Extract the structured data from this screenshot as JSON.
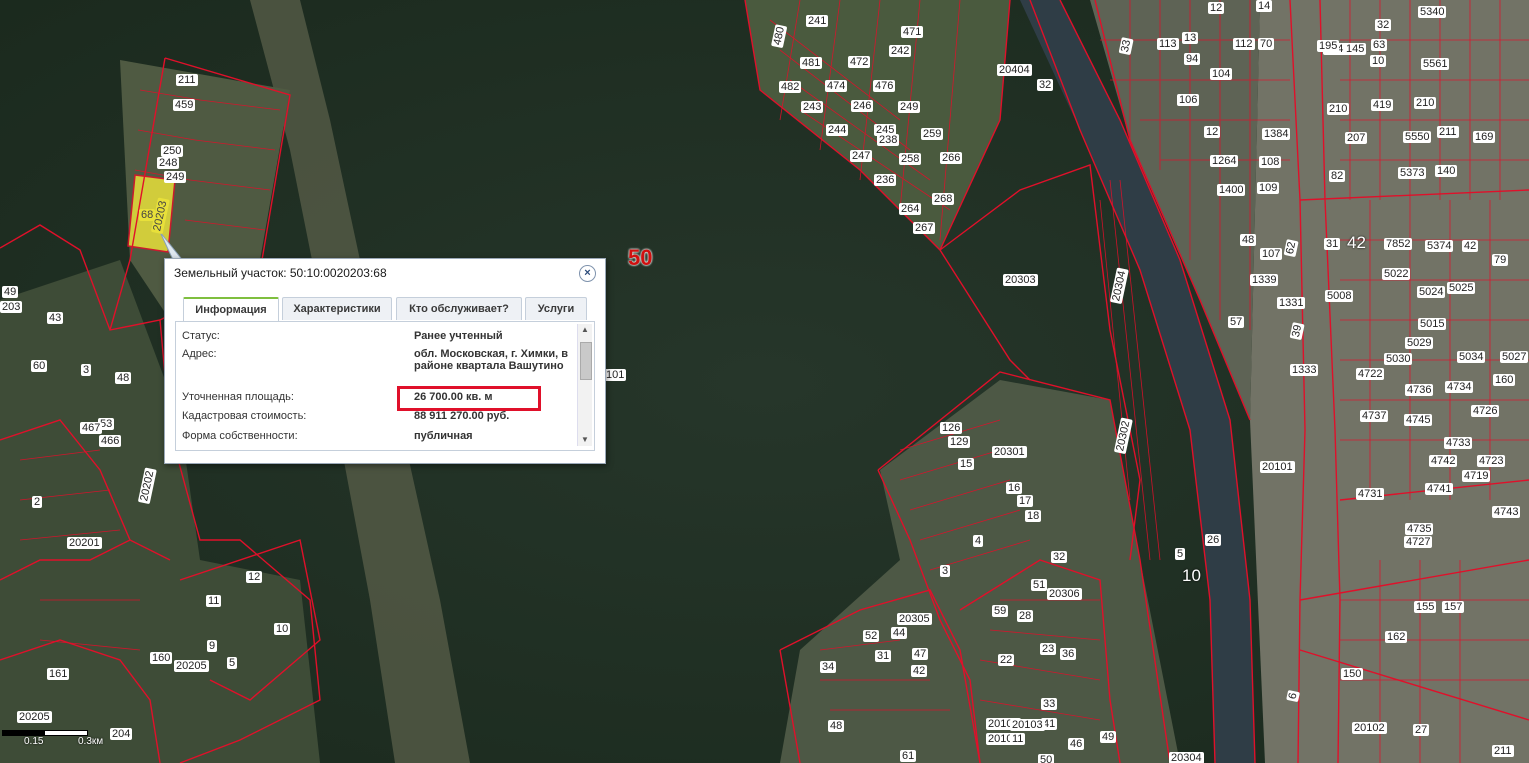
{
  "map": {
    "big_labels": [
      {
        "text": "50"
      }
    ],
    "mid_labels": [
      {
        "text": "42"
      },
      {
        "text": "10"
      }
    ],
    "parcel_labels": [
      "211",
      "459",
      "250",
      "248",
      "249",
      "68",
      "20203",
      "49",
      "203",
      "43",
      "60",
      "3",
      "48",
      "53",
      "467",
      "466",
      "20202",
      "2",
      "20201",
      "12",
      "11",
      "10",
      "160",
      "9",
      "5",
      "20205",
      "161",
      "20205",
      "204",
      "241",
      "471",
      "242",
      "480",
      "481",
      "472",
      "476",
      "482",
      "474",
      "243",
      "246",
      "249",
      "244",
      "245",
      "238",
      "259",
      "247",
      "236",
      "258",
      "266",
      "267",
      "264",
      "268",
      "20404",
      "32",
      "20303",
      "20304",
      "20301",
      "20302",
      "101",
      "126",
      "129",
      "15",
      "16",
      "17",
      "18",
      "4",
      "3",
      "20305",
      "52",
      "44",
      "47",
      "42",
      "34",
      "31",
      "32",
      "51",
      "59",
      "22",
      "20306",
      "28",
      "23",
      "36",
      "33",
      "41",
      "46",
      "49",
      "50",
      "48",
      "61",
      "20105",
      "20102",
      "20103",
      "11",
      "12",
      "14",
      "13",
      "94",
      "104",
      "70",
      "113",
      "112",
      "33",
      "106",
      "12",
      "1384",
      "1264",
      "108",
      "1400",
      "109",
      "48",
      "107",
      "62",
      "39",
      "1333",
      "1331",
      "1339",
      "57",
      "5",
      "26",
      "20101",
      "20304",
      "32",
      "63",
      "10",
      "5561",
      "5340",
      "5341",
      "195",
      "145",
      "210",
      "419",
      "210",
      "207",
      "5550",
      "211",
      "169",
      "82",
      "5373",
      "140",
      "31",
      "7852",
      "5374",
      "42",
      "79",
      "5022",
      "5024",
      "5025",
      "5015",
      "5008",
      "5029",
      "5030",
      "5034",
      "5027",
      "4722",
      "4736",
      "4734",
      "160",
      "4737",
      "4745",
      "4726",
      "4733",
      "4742",
      "4723",
      "4719",
      "4741",
      "4731",
      "4743",
      "4735",
      "4727",
      "162",
      "155",
      "157",
      "150",
      "20102",
      "6",
      "27",
      "211",
      "73",
      "20105",
      "20104",
      "2"
    ],
    "scale": {
      "left": "0.15",
      "right": "0.3км"
    }
  },
  "popup": {
    "title": "Земельный участок: 50:10:0020203:68",
    "close_label": "×",
    "tabs": [
      {
        "label": "Информация",
        "active": true
      },
      {
        "label": "Характеристики",
        "active": false
      },
      {
        "label": "Кто обслуживает?",
        "active": false
      },
      {
        "label": "Услуги",
        "active": false
      }
    ],
    "fields": [
      {
        "label": "Статус:",
        "value": "Ранее учтенный"
      },
      {
        "label": "Адрес:",
        "value": "обл. Московская, г. Химки, в районе квартала Вашутино"
      },
      {
        "label": "Уточненная площадь:",
        "value": "26 700.00 кв. м"
      },
      {
        "label": "Кадастровая стоимость:",
        "value": "88 911 270.00 руб."
      },
      {
        "label": "Форма собственности:",
        "value": "публичная"
      }
    ]
  },
  "colors": {
    "boundary": "#e0102a",
    "selected_parcel": "#e8e03a",
    "forest": "#243326",
    "active_tab_accent": "#7fbf3f"
  }
}
